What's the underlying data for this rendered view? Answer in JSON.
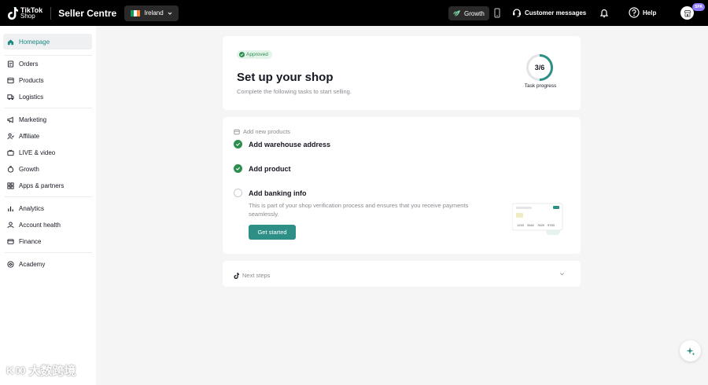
{
  "header": {
    "logo_line1": "TikTok",
    "logo_line2": "Shop",
    "brand": "Seller Centre",
    "region": "Ireland",
    "growth": "Growth",
    "customer_messages": "Customer messages",
    "help": "Help",
    "avatar_badge": "SPA",
    "flag_colors": [
      "#169b62",
      "#ffffff",
      "#ff883e"
    ]
  },
  "sidebar": {
    "items": [
      {
        "label": "Homepage",
        "icon": "home-icon",
        "active": true
      },
      {
        "label": "Orders",
        "icon": "orders-icon"
      },
      {
        "label": "Products",
        "icon": "products-icon"
      },
      {
        "label": "Logistics",
        "icon": "logistics-icon"
      },
      {
        "label": "Marketing",
        "icon": "megaphone-icon"
      },
      {
        "label": "Affiliate",
        "icon": "users-icon"
      },
      {
        "label": "LIVE & video",
        "icon": "live-icon"
      },
      {
        "label": "Growth",
        "icon": "growth-icon"
      },
      {
        "label": "Apps & partners",
        "icon": "apps-icon"
      },
      {
        "label": "Analytics",
        "icon": "analytics-icon"
      },
      {
        "label": "Account health",
        "icon": "account-health-icon"
      },
      {
        "label": "Finance",
        "icon": "finance-icon"
      },
      {
        "label": "Academy",
        "icon": "academy-icon"
      }
    ]
  },
  "setup": {
    "status": "Approved",
    "title": "Set up your shop",
    "subtitle": "Complete the following tasks to start selling.",
    "progress_value": "3/6",
    "progress_done": 3,
    "progress_total": 6,
    "progress_label": "Task progress"
  },
  "tasks": {
    "section_title": "Add new products",
    "items": [
      {
        "label": "Add warehouse address",
        "done": true
      },
      {
        "label": "Add product",
        "done": true
      },
      {
        "label": "Add banking info",
        "done": false
      }
    ],
    "banking_desc": "This is part of your shop verification process and ensures that you receive payments seamlessly.",
    "cta": "Get started",
    "card_numbers": [
      "1243",
      "3462",
      "7829",
      "9783"
    ]
  },
  "next": {
    "title": "Next steps"
  },
  "watermark": {
    "logo": "K 00",
    "text": "大数跨境"
  },
  "colors": {
    "accent": "#2d8f86",
    "success": "#2c8f4f",
    "active_nav": "#1d8a82"
  }
}
